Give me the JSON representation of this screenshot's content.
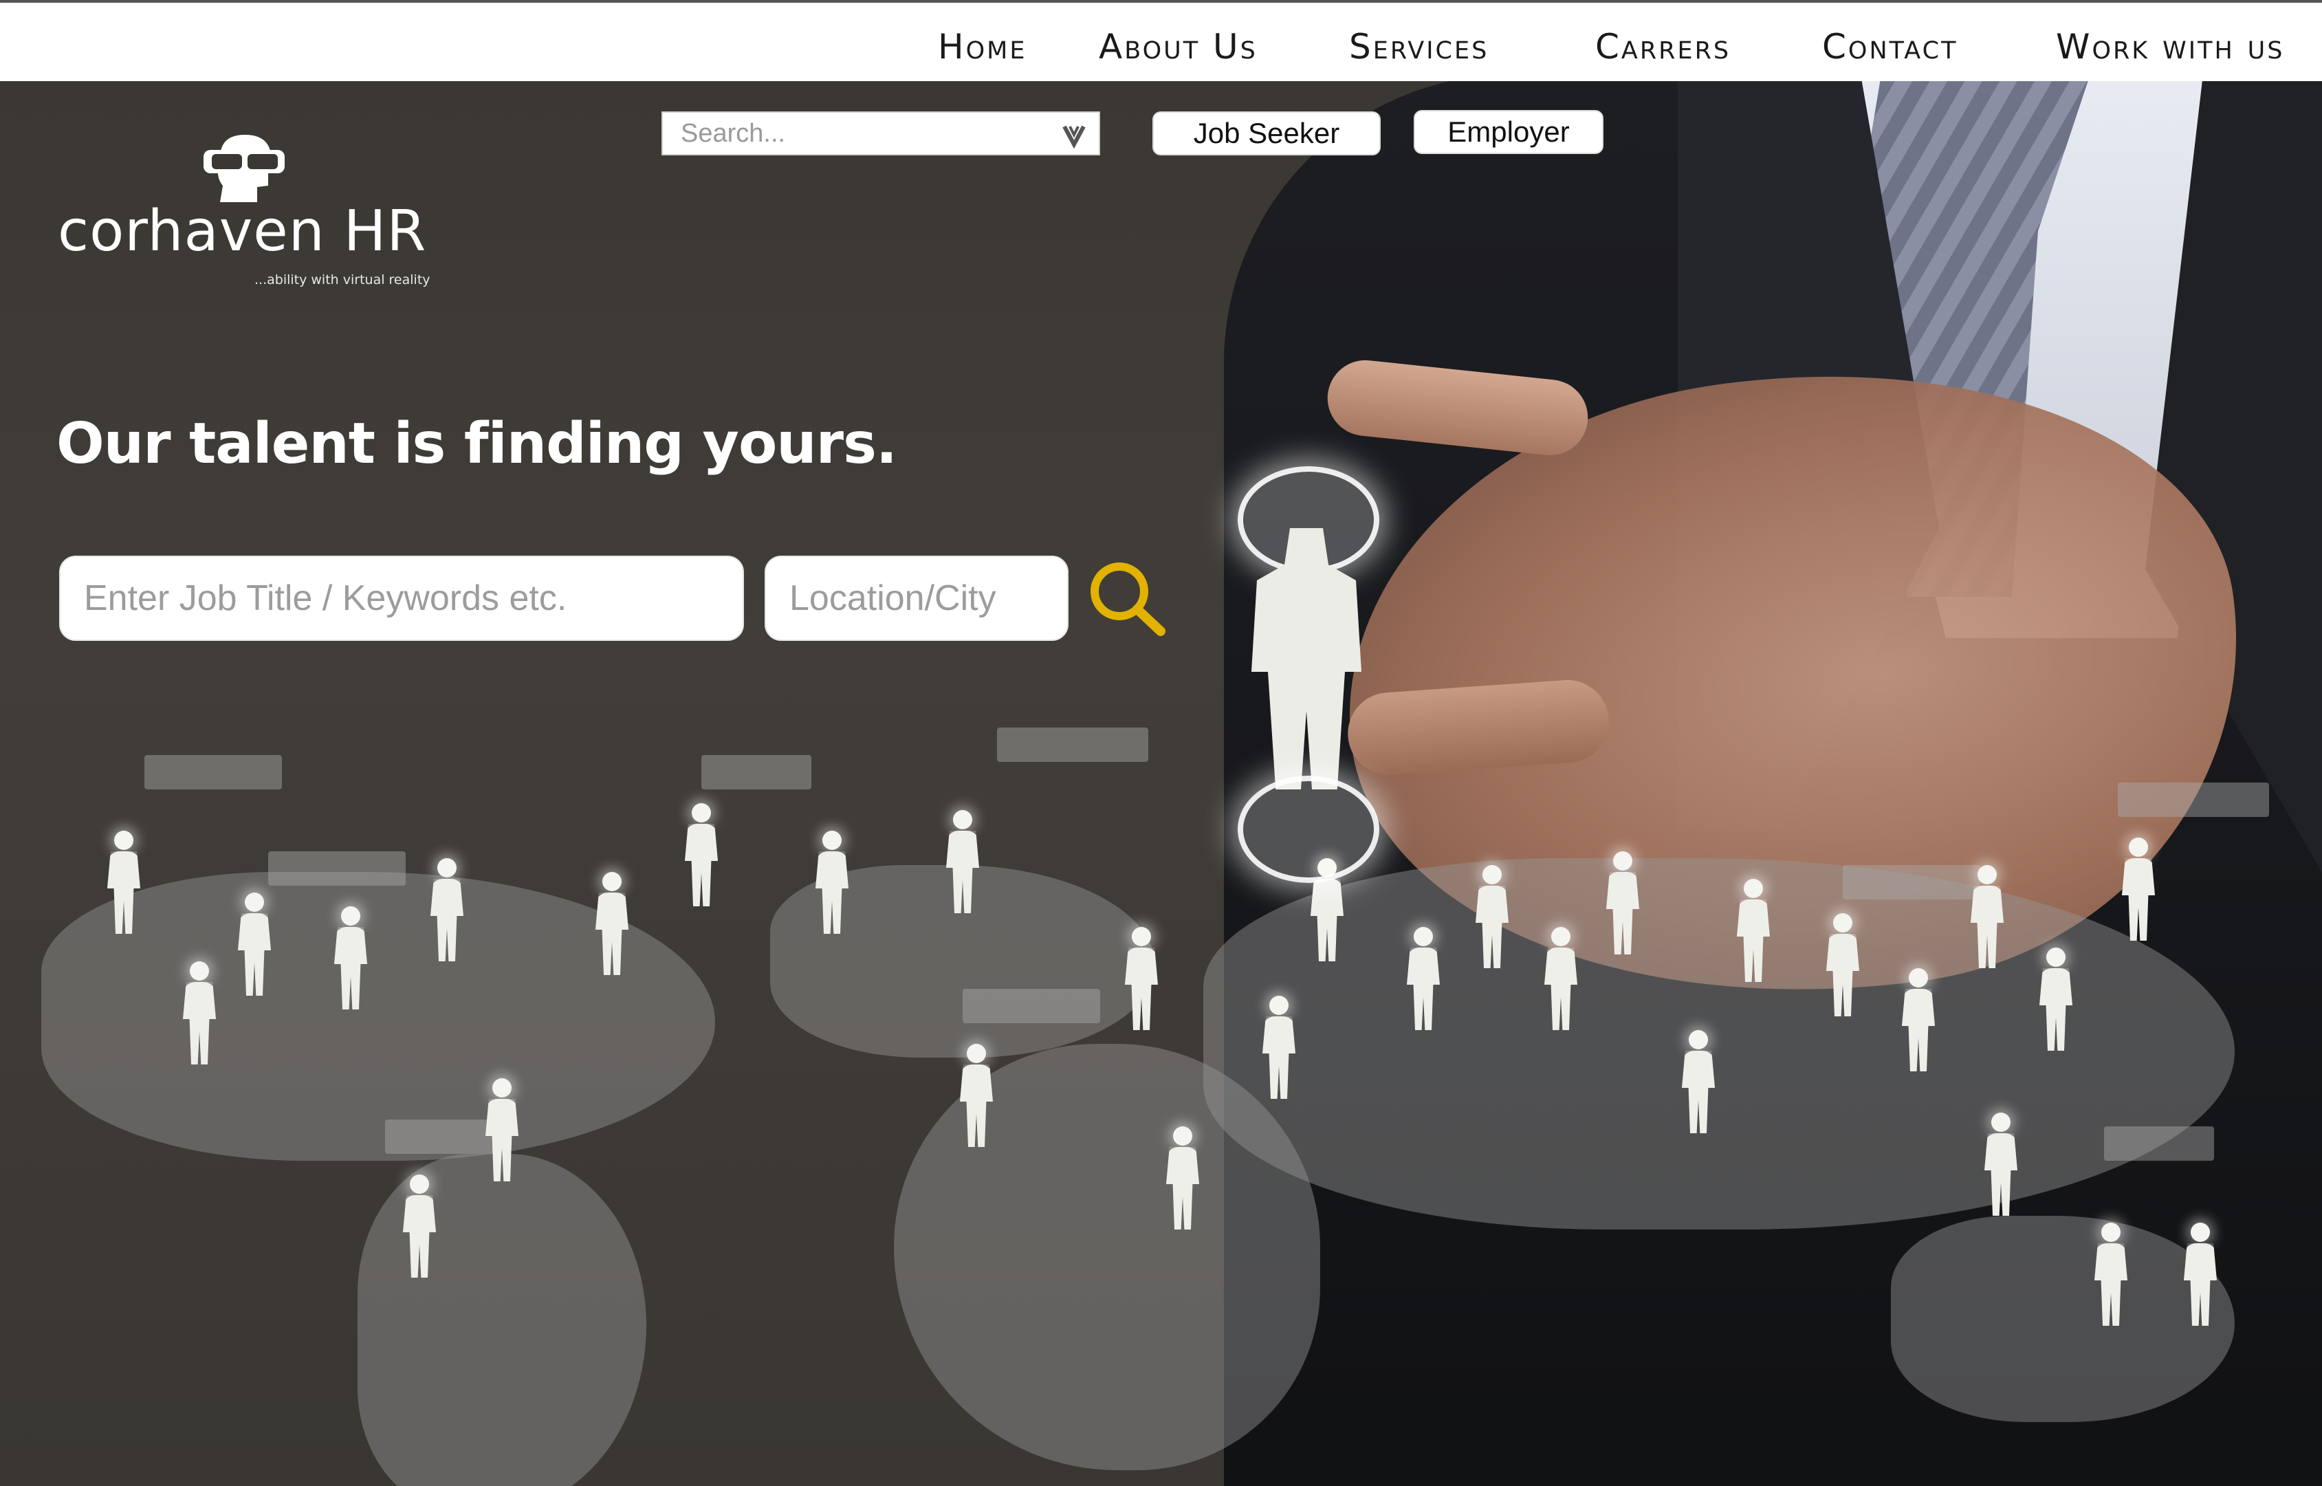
{
  "nav": {
    "items": [
      {
        "label": "Home"
      },
      {
        "label": "About Us"
      },
      {
        "label": "Services"
      },
      {
        "label": "Carrers"
      },
      {
        "label": "Contact"
      },
      {
        "label": "Work with us"
      }
    ]
  },
  "brand": {
    "name": "corhaven HR",
    "tagline": "...ability with virtual reality",
    "logo_icon": "vr-headset-person-icon"
  },
  "top_bar": {
    "search_placeholder": "Search...",
    "dropdown_icon": "chevron-down-icon",
    "job_seeker_label": "Job Seeker",
    "employer_label": "Employer"
  },
  "hero": {
    "headline": "Our talent is finding yours.",
    "job_input_placeholder": "Enter Job Title / Keywords etc.",
    "location_input_placeholder": "Location/City",
    "search_icon": "magnifier-icon"
  },
  "colors": {
    "accent": "#e2b200",
    "nav_text": "#1a1a1a",
    "hero_bg": "#3d3a36"
  }
}
